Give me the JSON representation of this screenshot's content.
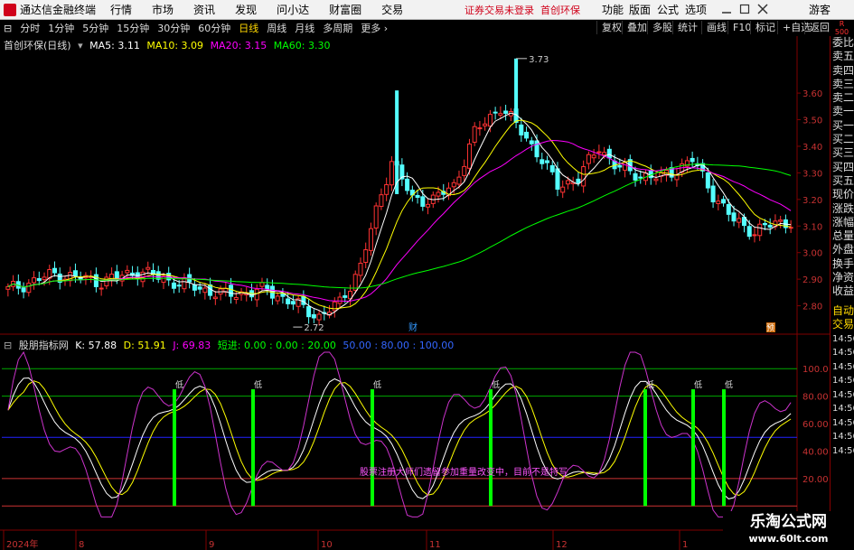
{
  "menubar": {
    "app_title": "通达信金融终端",
    "items": [
      "行情",
      "市场",
      "资讯",
      "发现",
      "问小达",
      "财富圈",
      "交易"
    ],
    "warning": "证券交易未登录",
    "stock_name": "首创环保",
    "right_items": [
      "功能",
      "版面",
      "公式",
      "选项"
    ],
    "guest": "游客"
  },
  "toolbar": {
    "periods": [
      "分时",
      "1分钟",
      "5分钟",
      "15分钟",
      "30分钟",
      "60分钟",
      "日线",
      "周线",
      "月线",
      "多周期",
      "更多"
    ],
    "active_period": "日线",
    "right_buttons": [
      "复权",
      "叠加",
      "多股",
      "统计",
      "画线",
      "F10",
      "标记",
      "+自选",
      "返回"
    ]
  },
  "rp_badge": "R\n500",
  "right_panel": {
    "labels": [
      "委比",
      "卖五",
      "卖四",
      "卖三",
      "卖二",
      "卖一",
      "买一",
      "买二",
      "买三",
      "买四",
      "买五",
      "现价",
      "涨跌",
      "涨幅",
      "总量",
      "外盘",
      "换手",
      "净资",
      "收益"
    ],
    "trade_labels": [
      "自动",
      "交易"
    ],
    "times": [
      "14:56",
      "14:56",
      "14:56",
      "14:56",
      "14:56",
      "14:56",
      "14:56",
      "14:56",
      "14:56"
    ]
  },
  "price_header": {
    "title": "首创环保(日线)",
    "ma5": "MA5: 3.11",
    "ma10": "MA10: 3.09",
    "ma20": "MA20: 3.15",
    "ma60": "MA60: 3.30"
  },
  "indicator_header": {
    "title": "股朋指标网",
    "k": "K: 57.88",
    "d": "D: 51.91",
    "j": "J: 69.83",
    "short": "短进: 0.00 : 0.00 : 20.00",
    "mid": "50.00 : 80.00 : 100.00"
  },
  "price_axis": [
    "3.60",
    "3.50",
    "3.40",
    "3.30",
    "3.20",
    "3.10",
    "3.00",
    "2.90",
    "2.80"
  ],
  "ind_axis": [
    "100.0",
    "80.00",
    "60.00",
    "40.00",
    "20.00"
  ],
  "annotations": {
    "high": "3.73",
    "low": "2.72",
    "cai": "财",
    "yu": "预",
    "di": "低",
    "overlay_text": "股票注册大师们遗留参加重量改变中，目前不是特写"
  },
  "date_axis": [
    "2024年",
    "8",
    "9",
    "10",
    "11",
    "12",
    "1"
  ],
  "watermark": {
    "line1": "乐淘公式网",
    "line2": "www.60lt.com"
  },
  "colors": {
    "up": "#ff3333",
    "down": "#54ffff",
    "ma5": "#ffffff",
    "ma10": "#ffff00",
    "ma20": "#ff00ff",
    "ma60": "#00ff00",
    "k": "#ffffff",
    "d": "#ffff00",
    "j": "#cc33cc",
    "signal": "#00ff00"
  }
}
